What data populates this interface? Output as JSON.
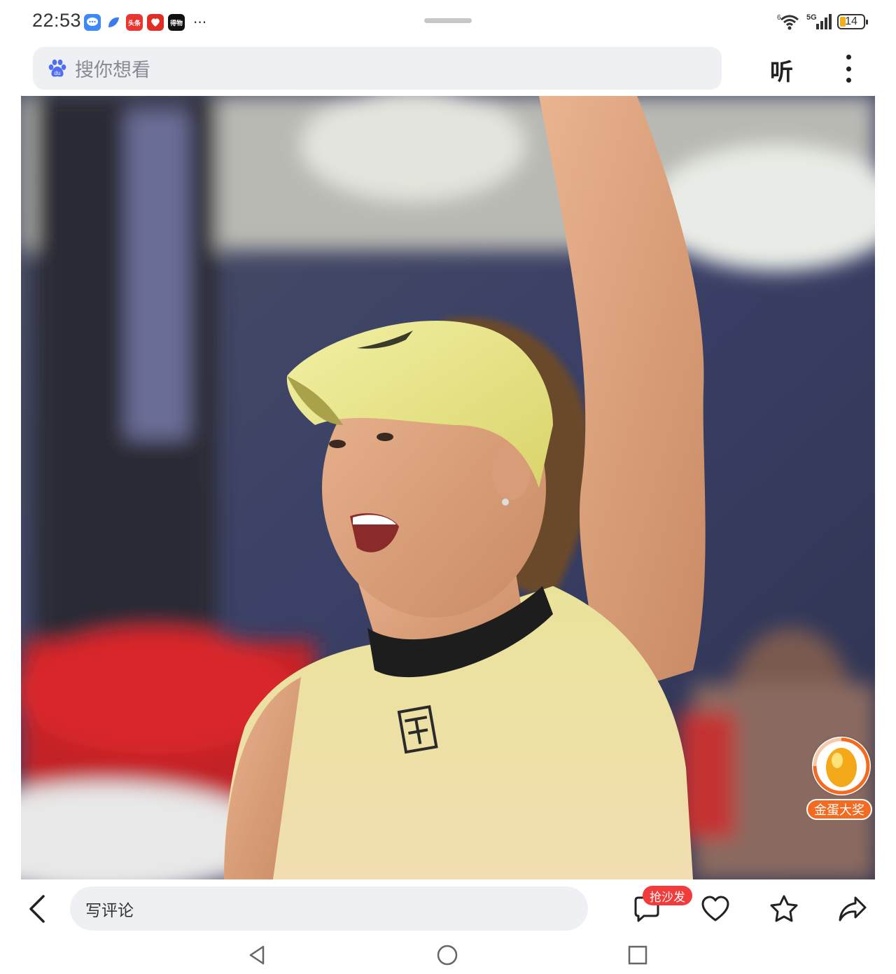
{
  "status_bar": {
    "time": "22:53",
    "notification_icons": [
      "message-icon",
      "blue-app-icon",
      "toutiao-icon",
      "pinduoduo-icon",
      "dewu-icon"
    ],
    "notification_labels": {
      "toutiao": "头条",
      "dewu": "得物"
    },
    "more": "···",
    "network": "5G",
    "wifi_sub": "6",
    "battery_level": "14",
    "battery_color": "#f0b21c"
  },
  "search": {
    "placeholder": "搜你想看",
    "listen_label": "听"
  },
  "article": {
    "image_description_icon": "photo-tennis-player",
    "egg_widget": {
      "label": "金蛋大奖",
      "icon": "golden-egg-icon",
      "accent": "#f26b21"
    }
  },
  "bottom_bar": {
    "comment_placeholder": "写评论",
    "sofa_badge": "抢沙发",
    "badge_color": "#f23b3b"
  },
  "nav_bar": {
    "buttons": [
      "nav-back-icon",
      "nav-home-icon",
      "nav-recent-icon"
    ]
  }
}
